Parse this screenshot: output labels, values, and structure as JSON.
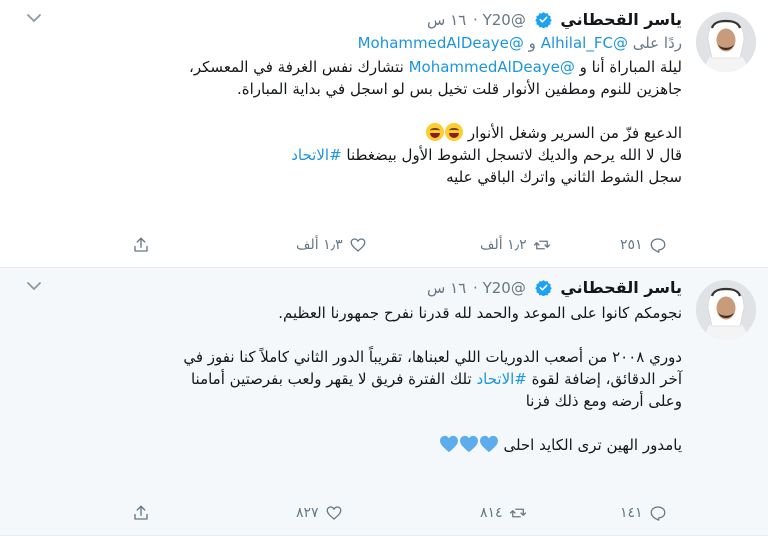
{
  "tweets": [
    {
      "author_name": "ياسر القحطاني",
      "handle": "@Y20",
      "separator": "·",
      "time": "١٦ س",
      "replying_prefix": "ردًا على",
      "replying_mention_1": "@Alhilal_FC",
      "replying_joiner": "و",
      "replying_mention_2": "@MohammedAlDeaye",
      "line_1a": "ليلة المباراة أنا و ",
      "line_1_mention": "@MohammedAlDeaye",
      "line_1b": " نتشارك نفس الغرفة في المعسكر،",
      "line_2": "جاهزين للنوم ومطفين الأنوار قلت تخيل بس لو اسجل في بداية المباراة.",
      "line_3": "الدعيع فزّ من السرير وشغل الأنوار",
      "line_4a": "قال لا الله يرحم والديك لاتسجل الشوط الأول بيضغطنا ",
      "line_4_hashtag": "#الاتحاد",
      "line_5": "سجل الشوط الثاني واترك الباقي عليه",
      "reply_count": "٢٥١",
      "retweet_count": "١٫٢ ألف",
      "like_count": "١٫٣ ألف"
    },
    {
      "author_name": "ياسر القحطاني",
      "handle": "@Y20",
      "separator": "·",
      "time": "١٦ س",
      "line_1": "نجومكم كانوا على الموعد والحمد لله قدرنا نفرح جمهورنا العظيم.",
      "line_2": "دوري ٢٠٠٨ من أصعب الدوريات اللي لعبناها، تقريباً الدور الثاني كاملاً كنا نفوز في",
      "line_3a": "آخر الدقائق، إضافة لقوة ",
      "line_3_hashtag": "#الاتحاد",
      "line_3b": " تلك الفترة فريق لا يقهر ولعب بفرصتين أمامنا",
      "line_4": "وعلى أرضه ومع ذلك فزنا",
      "line_5": "يامدور الهين ترى الكايد احلى",
      "reply_count": "١٤١",
      "retweet_count": "٨١٤",
      "like_count": "٨٢٧"
    }
  ],
  "colors": {
    "accent": "#1b95e0",
    "muted": "#657786",
    "verified": "#1da1f2",
    "blue_heart": "#5dadec"
  },
  "icons": {
    "caret": "chevron-down-icon",
    "verified": "verified-badge-icon",
    "reply": "reply-icon",
    "retweet": "retweet-icon",
    "like": "heart-outline-icon",
    "share": "share-icon"
  }
}
